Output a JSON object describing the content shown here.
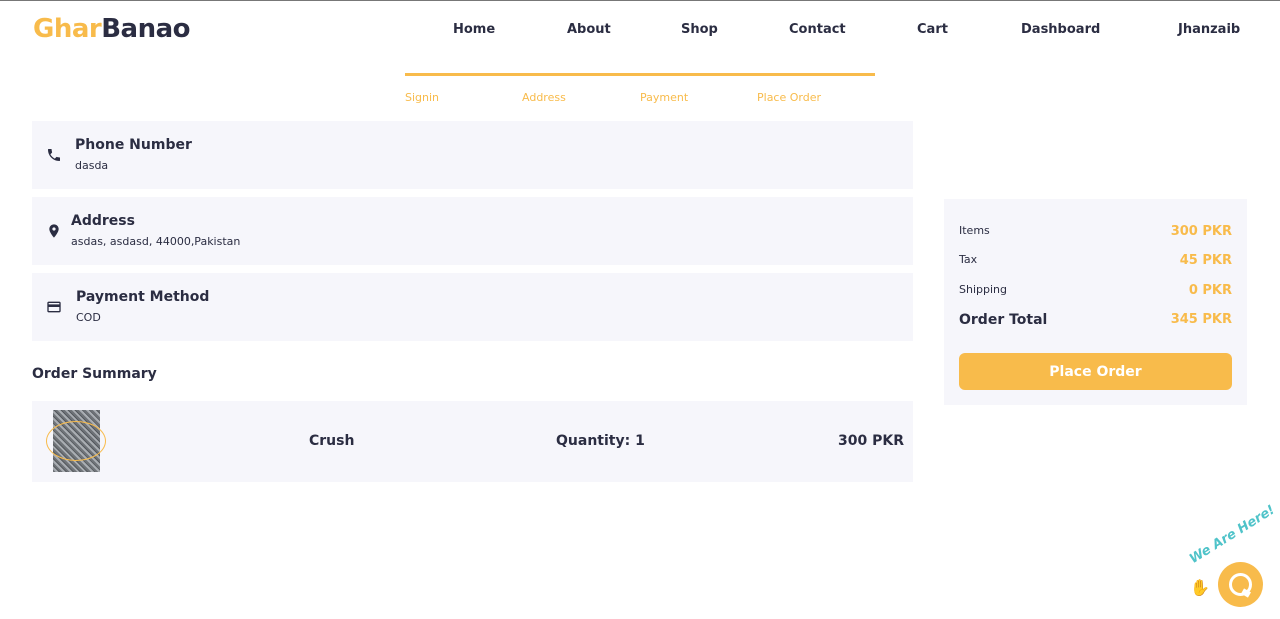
{
  "brand": {
    "part1": "Ghar",
    "part2": "Banao",
    "accent": "#f8bb4b",
    "dark": "#2b2d42"
  },
  "nav": {
    "home": "Home",
    "about": "About",
    "shop": "Shop",
    "contact": "Contact",
    "cart": "Cart",
    "dashboard": "Dashboard",
    "user": "Jhanzaib"
  },
  "checkout_steps": {
    "s1": "Signin",
    "s2": "Address",
    "s3": "Payment",
    "s4": "Place Order"
  },
  "phone": {
    "title": "Phone Number",
    "value": "dasda",
    "icon": "phone-icon"
  },
  "address": {
    "title": "Address",
    "value": "asdas, asdasd, 44000,Pakistan",
    "icon": "location-pin-icon"
  },
  "payment": {
    "title": "Payment Method",
    "value": "COD",
    "icon": "credit-card-icon"
  },
  "order_summary": {
    "heading": "Order Summary",
    "items": [
      {
        "name": "Crush",
        "quantity": "Quantity: 1",
        "price": "300 PKR"
      }
    ]
  },
  "summary": {
    "items_label": "Items",
    "items_value": "300 PKR",
    "tax_label": "Tax",
    "tax_value": "45 PKR",
    "shipping_label": "Shipping",
    "shipping_value": "0 PKR",
    "total_label": "Order Total",
    "total_value": "345 PKR",
    "button": "Place Order"
  },
  "chat_widget": {
    "tagline": "We Are Here!",
    "icon": "chat-icon"
  }
}
